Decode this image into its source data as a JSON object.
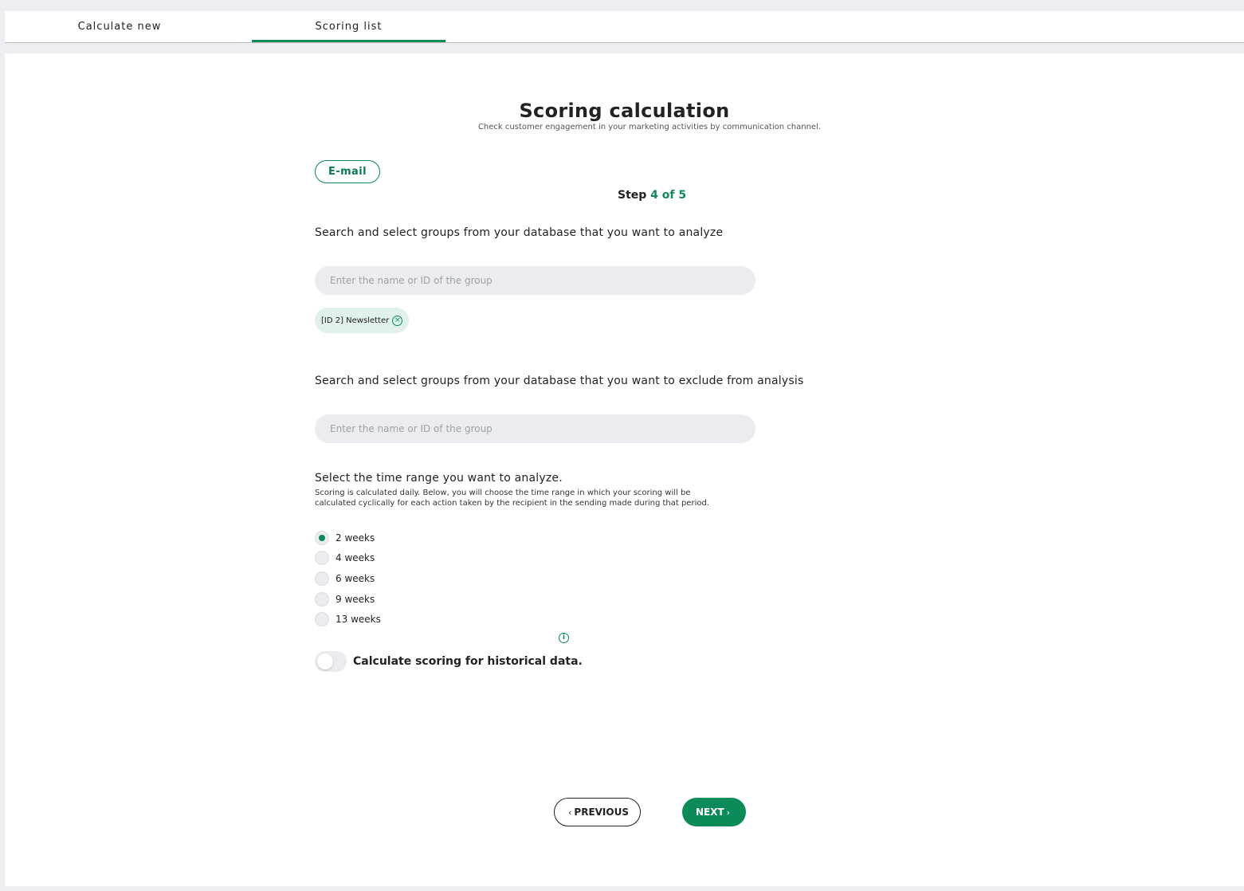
{
  "tabs": [
    {
      "label": "Calculate new",
      "active": false
    },
    {
      "label": "Scoring list",
      "active": true
    }
  ],
  "page": {
    "title": "Scoring calculation",
    "subtitle": "Check customer engagement in your marketing activities by communication channel."
  },
  "channel": {
    "label": "E-mail"
  },
  "step": {
    "prefix": "Step",
    "current": "4 of 5"
  },
  "include_groups": {
    "label": "Search and select groups from your database that you want to analyze",
    "placeholder": "Enter the name or ID of the group",
    "value": "",
    "selected": [
      {
        "label": "[ID 2] Newsletter",
        "remove_icon": "close-circle-icon"
      }
    ]
  },
  "exclude_groups": {
    "label": "Search and select groups from your database that you want to exclude from analysis",
    "placeholder": "Enter the name or ID of the group",
    "value": ""
  },
  "time_range": {
    "label": "Select the time range you want to analyze.",
    "description": "Scoring is calculated daily. Below, you will choose the time range in which your scoring will be calculated cyclically for each action taken by the recipient in the sending made during that period.",
    "options": [
      {
        "label": "2 weeks",
        "selected": true
      },
      {
        "label": "4 weeks",
        "selected": false
      },
      {
        "label": "6 weeks",
        "selected": false
      },
      {
        "label": "9 weeks",
        "selected": false
      },
      {
        "label": "13 weeks",
        "selected": false
      }
    ],
    "info_icon": "info-icon"
  },
  "historical": {
    "label": "Calculate scoring for historical data.",
    "enabled": false
  },
  "nav": {
    "previous_label": "PREVIOUS",
    "next_label": "NEXT"
  },
  "colors": {
    "accent": "#0b8a5a",
    "chip_bg": "#dff1ea",
    "input_bg": "#ececf0",
    "page_bg": "#eeeef2"
  }
}
